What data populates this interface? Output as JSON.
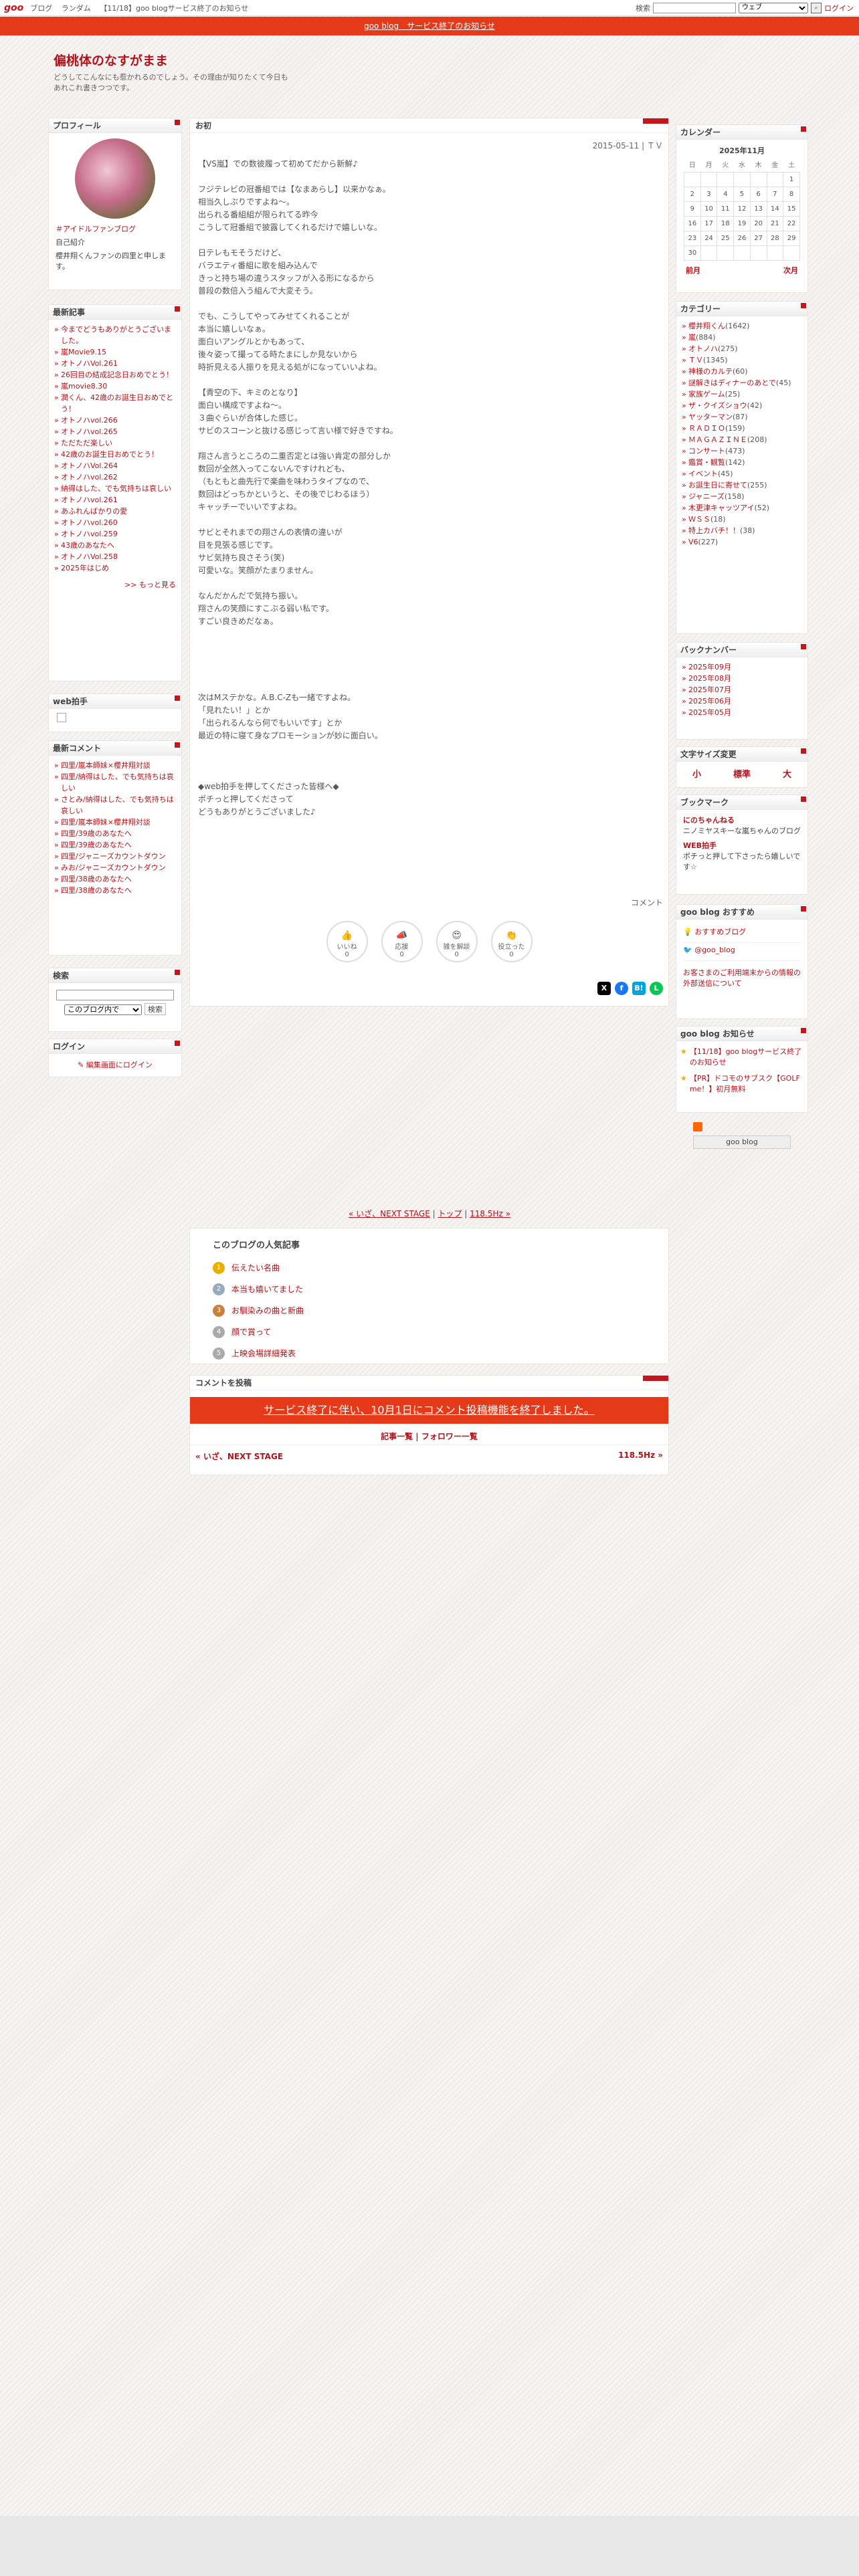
{
  "header": {
    "logo": "goo",
    "nav": [
      "ブログ",
      "ランダム",
      "【11/18】goo blogサービス終了のお知らせ"
    ],
    "search_label": "検索",
    "search_select": "ウェブ",
    "login": "ログイン"
  },
  "notice": "goo blog　サービス終了のお知らせ",
  "blog": {
    "title": "偏桃体のなすがまま",
    "desc": "どうしてこんなにも惹かれるのでしょう。その理由が知りたくて今日もあれこれ書きつつです。"
  },
  "profile": {
    "title": "プロフィール",
    "tag": "＃アイドルファンブログ",
    "intro_label": "自己紹介",
    "intro": "櫻井翔くんファンの四里と申します。"
  },
  "recent": {
    "title": "最新記事",
    "items": [
      "今までどうもありがとうございました。",
      "嵐Movie9.15",
      "オトノハVol.261",
      "26回目の結成記念日おめでとう！",
      "嵐movie8.30",
      "潤くん、42歳のお誕生日おめでとう！",
      "オトノハvol.266",
      "オトノハvol.265",
      "ただただ楽しい",
      "42歳のお誕生日おめでとう！",
      "オトノハVol.264",
      "オトノハvol.262",
      "納得はした、でも気持ちは哀しい",
      "オトノハvol.261",
      "あふれんばかりの愛",
      "オトノハvol.260",
      "オトノハvol.259",
      "43歳のあなたへ",
      "オトノハVol.258",
      "2025年はじめ"
    ],
    "more": ">> もっと見る"
  },
  "webpat": {
    "title": "web拍手"
  },
  "comments": {
    "title": "最新コメント",
    "items": [
      "四里/嵐本師妹×櫻井翔対談",
      "四里/納得はした、でも気持ちは哀しい",
      "さとみ/納得はした、でも気持ちは哀しい",
      "四里/嵐本師妹×櫻井翔対談",
      "四里/39歳のあなたへ",
      "四里/39歳のあなたへ",
      "四里/ジャニーズカウントダウン",
      "みお/ジャニーズカウントダウン",
      "四里/38歳のあなたへ",
      "四里/38歳のあなたへ"
    ]
  },
  "search": {
    "title": "検索",
    "select": "このブログ内で",
    "button": "検索"
  },
  "login": {
    "title": "ログイン",
    "link": "編集画面にログイン"
  },
  "post": {
    "title": "お初",
    "date": "2015-05-11 | ＴＶ",
    "paragraphs": [
      "【VS嵐】での数彼履って初めてだから新鮮♪",
      "フジテレビの冠番組では【なまあらし】以来かなぁ。\n相当久しぶりですよね〜。\n出られる番組組が限られてる昨今\nこうして冠番組で披露してくれるだけで嬉しいな。",
      "日テレもモそうだけど、\nバラエティ番組に歌を組み込んで\nきっと持ち場の違うスタッフが入る形になるから\n普段の数倍入う組んで大変そう。",
      "でも、こうしてやってみせてくれることが\n本当に嬉しいなぁ。\n面白いアングルとかもあって、\n後々姿って撮ってる時たまにしか見ないから\n時折見える人振りを見える処がになっていいよね。",
      "【青空の下、キミのとなり】\n面白い構成ですよね〜。\n３曲ぐらいが合体した感じ。\nサビのスコーンと抜ける感じって言い様で好きですね。",
      "翔さん言うところの二重否定とは強い肯定の部分しか\n数回が全然入ってこないんですけれども、\n（もともと曲先行で楽曲を味わうタイプなので、\n数回はどっちかというと、その後でじわるほう）\nキャッチーでいいですよね。",
      "サビとそれまでの翔さんの表情の違いが\n目を見張る感じです。\nサビ気持ち良さそう(笑)\n可愛いな。笑顔がたまりません。",
      "なんだかんだで気持ち振い。\n翔さんの笑顔にすこぶる弱い私です。\nすごい良きめだなぁ。",
      "",
      "",
      "次はMステかな。A.B.C-Zも一緒ですよね。\n「見れたい！」とか\n「出られるんなら何でもいいです」とか\n最近の特に寝て身なプロモーションが妙に面白い。",
      "",
      "◆web拍手を押してくださった皆様へ◆\nポチっと押してくださって\nどうもありがとうございました♪"
    ],
    "comment_label": "コメント",
    "reactions": [
      {
        "label": "いいね",
        "count": "0"
      },
      {
        "label": "応援",
        "count": "0"
      },
      {
        "label": "雑を解談",
        "count": "0"
      },
      {
        "label": "役立った",
        "count": "0"
      }
    ]
  },
  "calendar": {
    "title": "カレンダー",
    "month": "2025年11月",
    "prev": "前月",
    "next": "次月",
    "week": [
      "日",
      "月",
      "火",
      "水",
      "木",
      "金",
      "土"
    ],
    "days": [
      "",
      "",
      "",
      "",
      "",
      "",
      "1",
      "2",
      "3",
      "4",
      "5",
      "6",
      "7",
      "8",
      "9",
      "10",
      "11",
      "12",
      "13",
      "14",
      "15",
      "16",
      "17",
      "18",
      "19",
      "20",
      "21",
      "22",
      "23",
      "24",
      "25",
      "26",
      "27",
      "28",
      "29",
      "30",
      "",
      "",
      "",
      "",
      "",
      ""
    ]
  },
  "category": {
    "title": "カテゴリー",
    "items": [
      {
        "n": "櫻井翔くん",
        "c": "(1642)"
      },
      {
        "n": "嵐",
        "c": "(884)"
      },
      {
        "n": "オトノハ",
        "c": "(275)"
      },
      {
        "n": "ＴＶ",
        "c": "(1345)"
      },
      {
        "n": "神様のカルテ",
        "c": "(60)"
      },
      {
        "n": "謎解きはディナーのあとで",
        "c": "(45)"
      },
      {
        "n": "家族ゲーム",
        "c": "(25)"
      },
      {
        "n": "ザ・クイズショウ",
        "c": "(42)"
      },
      {
        "n": "ヤッターマン",
        "c": "(87)"
      },
      {
        "n": "ＲＡＤＩＯ",
        "c": "(159)"
      },
      {
        "n": "ＭＡＧＡＺＩＮＥ",
        "c": "(208)"
      },
      {
        "n": "コンサート",
        "c": "(473)"
      },
      {
        "n": "鑑賞・観覧",
        "c": "(142)"
      },
      {
        "n": "イベント",
        "c": "(45)"
      },
      {
        "n": "お誕生日に寄せて",
        "c": "(255)"
      },
      {
        "n": "ジャニーズ",
        "c": "(158)"
      },
      {
        "n": "木更津キャッツアイ",
        "c": "(52)"
      },
      {
        "n": "ＷＳＳ",
        "c": "(18)"
      },
      {
        "n": "特上カバチ！！",
        "c": "(38)"
      },
      {
        "n": "V6",
        "c": "(227)"
      }
    ]
  },
  "backnumber": {
    "title": "バックナンバー",
    "items": [
      "2025年09月",
      "2025年08月",
      "2025年07月",
      "2025年06月",
      "2025年05月"
    ]
  },
  "fontsize": {
    "title": "文字サイズ変更",
    "small": "小",
    "mid": "標準",
    "large": "大"
  },
  "bookmark": {
    "title": "ブックマーク",
    "items": [
      {
        "n": "にのちゃんねる",
        "d": "ニノミヤスキーな嵐ちゃんのブログ"
      },
      {
        "n": "WEB拍手",
        "d": "ポチっと押して下さったら嬉しいです☆"
      }
    ]
  },
  "goorec": {
    "title": "goo blog おすすめ",
    "items": [
      "おすすめブログ",
      "@goo_blog"
    ],
    "note": "お客さまのご利用端末からの情報の外部送信について"
  },
  "goonews": {
    "title": "goo blog お知らせ",
    "items": [
      "【11/18】goo blogサービス終了のお知らせ",
      "【PR】ドコモのサブスク【GOLF me！】初月無料"
    ]
  },
  "feed": {
    "label": "goo blog"
  },
  "prevnext": {
    "prev": "« いざ、NEXT STAGE",
    "top": "トップ",
    "next": "118.5Hz »"
  },
  "popular": {
    "title": "このブログの人気記事",
    "items": [
      "伝えたい名曲",
      "本当も嬉いてました",
      "お馴染みの曲と新曲",
      "顔で賞って",
      "上映会場詳細発表"
    ]
  },
  "commentpost": {
    "title": "コメントを投稿",
    "notice": "サービス終了に伴い、10月1日にコメント投稿機能を終了しました。",
    "links": "記事一覧 | フォロワー一覧",
    "prev": "« いざ、NEXT STAGE",
    "next": "118.5Hz »"
  }
}
